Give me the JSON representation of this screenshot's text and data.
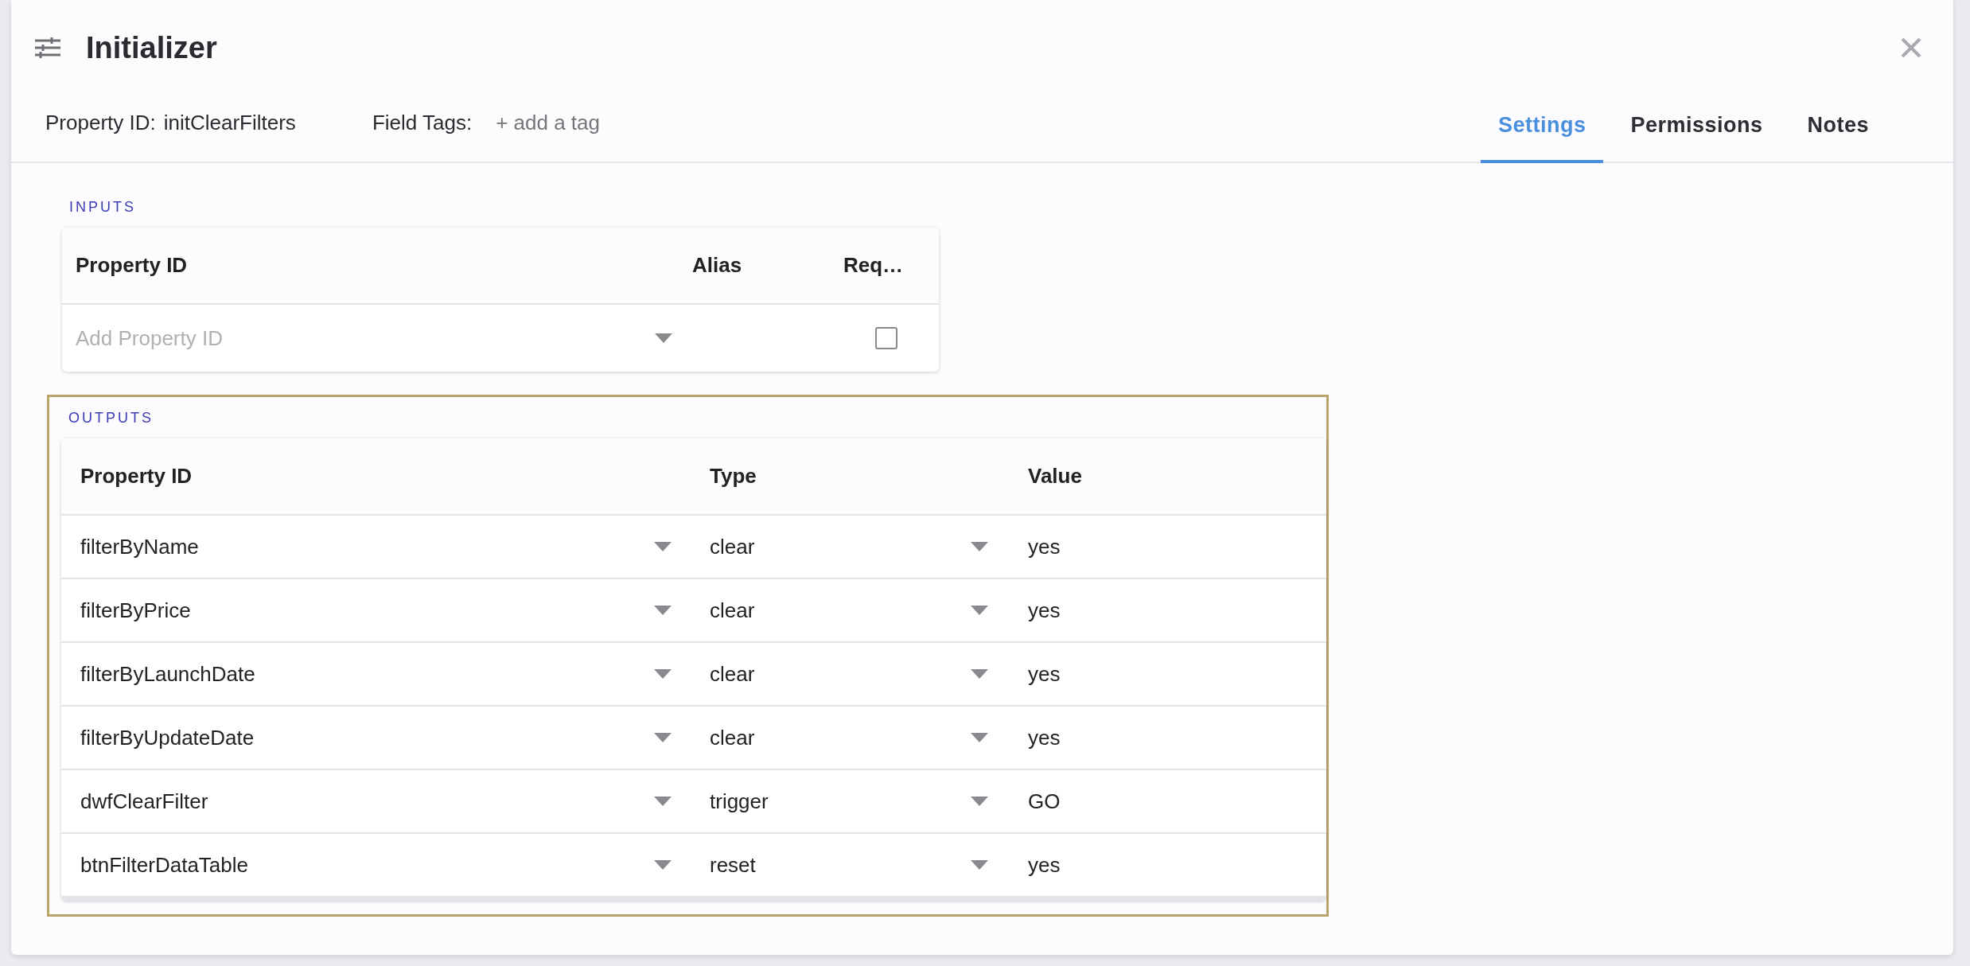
{
  "dialog": {
    "title": "Initializer",
    "property_id_label": "Property ID:",
    "property_id": "initClearFilters",
    "field_tags_label": "Field Tags:",
    "add_tag": "+ add a tag"
  },
  "tabs": [
    {
      "label": "Settings",
      "selected": true
    },
    {
      "label": "Permissions",
      "selected": false
    },
    {
      "label": "Notes",
      "selected": false
    }
  ],
  "inputs": {
    "heading": "INPUTS",
    "columns": [
      "Property ID",
      "Alias",
      "Req…"
    ],
    "rows": [
      {
        "property_id_placeholder": "Add Property ID",
        "required": false
      }
    ]
  },
  "outputs": {
    "heading": "OUTPUTS",
    "highlighted": true,
    "columns": [
      "Property ID",
      "Type",
      "Value"
    ],
    "rows": [
      {
        "property_id": "filterByName",
        "type": "clear",
        "value": "yes"
      },
      {
        "property_id": "filterByPrice",
        "type": "clear",
        "value": "yes"
      },
      {
        "property_id": "filterByLaunchDate",
        "type": "clear",
        "value": "yes"
      },
      {
        "property_id": "filterByUpdateDate",
        "type": "clear",
        "value": "yes"
      },
      {
        "property_id": "dwfClearFilter",
        "type": "trigger",
        "value": "GO"
      },
      {
        "property_id": "btnFilterDataTable",
        "type": "reset",
        "value": "yes"
      }
    ]
  }
}
